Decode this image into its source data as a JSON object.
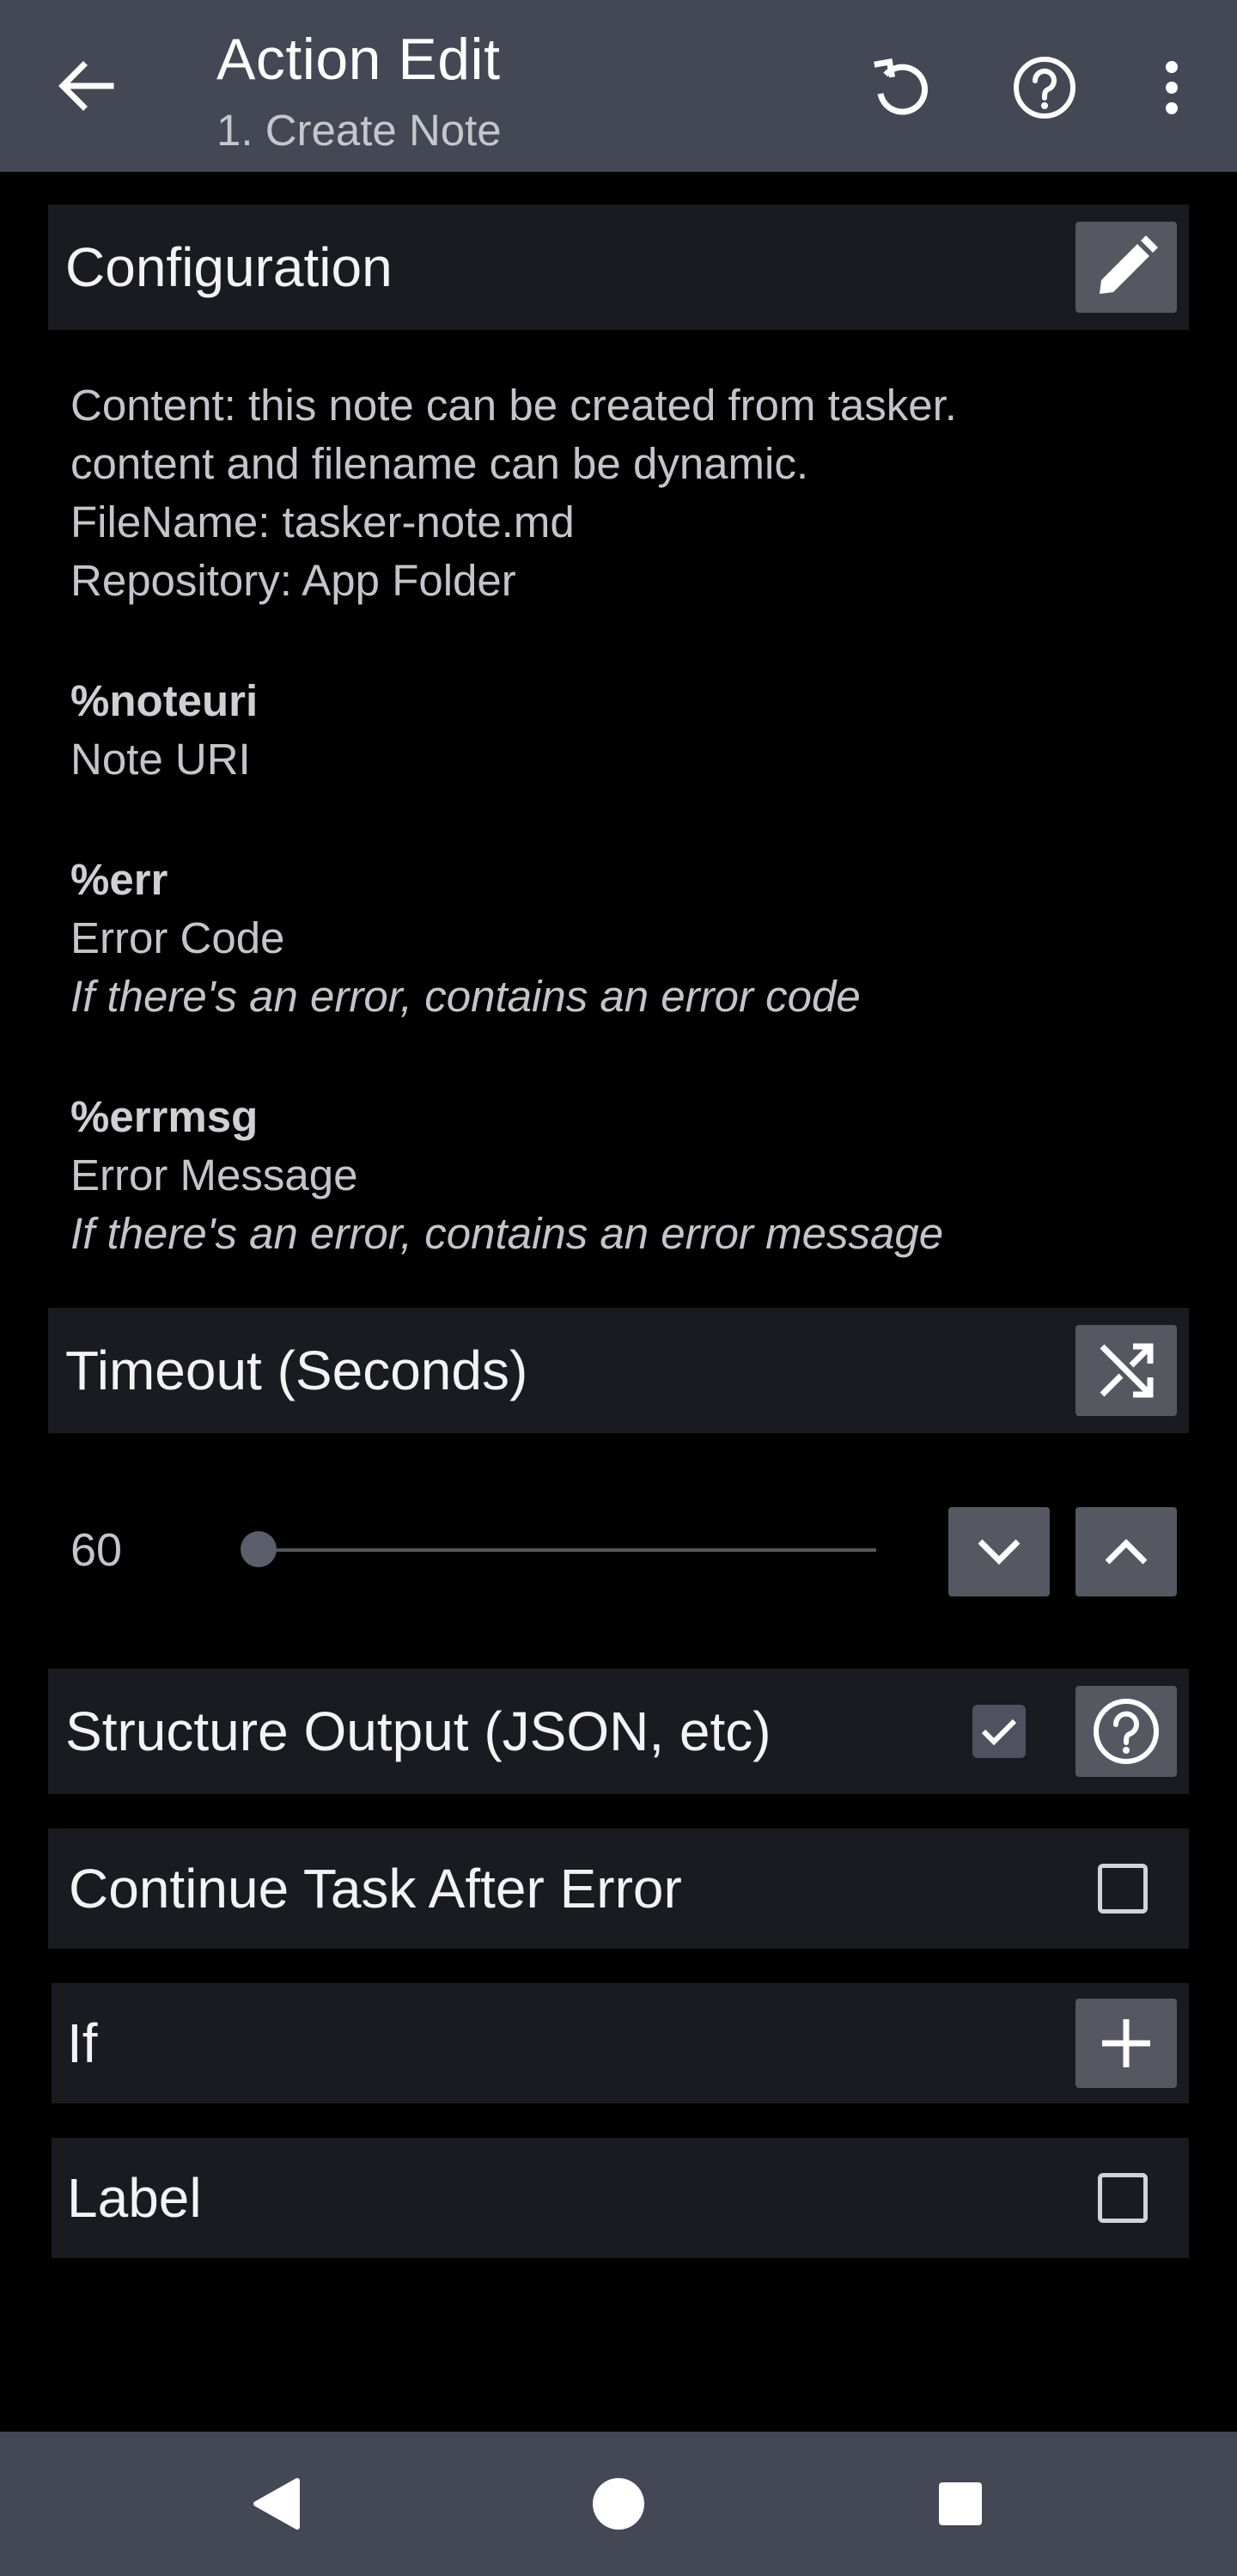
{
  "header": {
    "title": "Action Edit",
    "subtitle": "1. Create Note",
    "back_icon": "arrow-left-icon",
    "reset_icon": "restore-icon",
    "help_icon": "help-circle-icon",
    "menu_icon": "more-vertical-icon"
  },
  "configuration": {
    "title": "Configuration",
    "edit_icon": "pencil-icon",
    "lines": [
      "Content: this note can be created from tasker.",
      "content and filename can be dynamic.",
      "FileName: tasker-note.md",
      "Repository: App Folder"
    ],
    "variables": [
      {
        "name": "%noteuri",
        "label": "Note URI",
        "note": ""
      },
      {
        "name": "%err",
        "label": "Error Code",
        "note": "If there's an error, contains an error code"
      },
      {
        "name": "%errmsg",
        "label": "Error Message",
        "note": "If there's an error, contains an error message"
      }
    ]
  },
  "timeout": {
    "title": "Timeout (Seconds)",
    "shuffle_icon": "shuffle-icon",
    "value": "60",
    "decrease_icon": "chevron-down-icon",
    "increase_icon": "chevron-up-icon"
  },
  "structure_output": {
    "label": "Structure Output (JSON, etc)",
    "checked": true,
    "help_icon": "help-circle-icon"
  },
  "continue_after_error": {
    "label": "Continue Task After Error",
    "checked": false
  },
  "if_row": {
    "label": "If",
    "add_icon": "plus-icon"
  },
  "label_row": {
    "label": "Label",
    "checked": false
  },
  "navbar": {
    "back_icon": "nav-back-icon",
    "home_icon": "nav-home-icon",
    "recents_icon": "nav-recents-icon"
  },
  "colors": {
    "bar_background": "#444754",
    "section_background": "#1a1b20",
    "button_background": "#555761"
  }
}
